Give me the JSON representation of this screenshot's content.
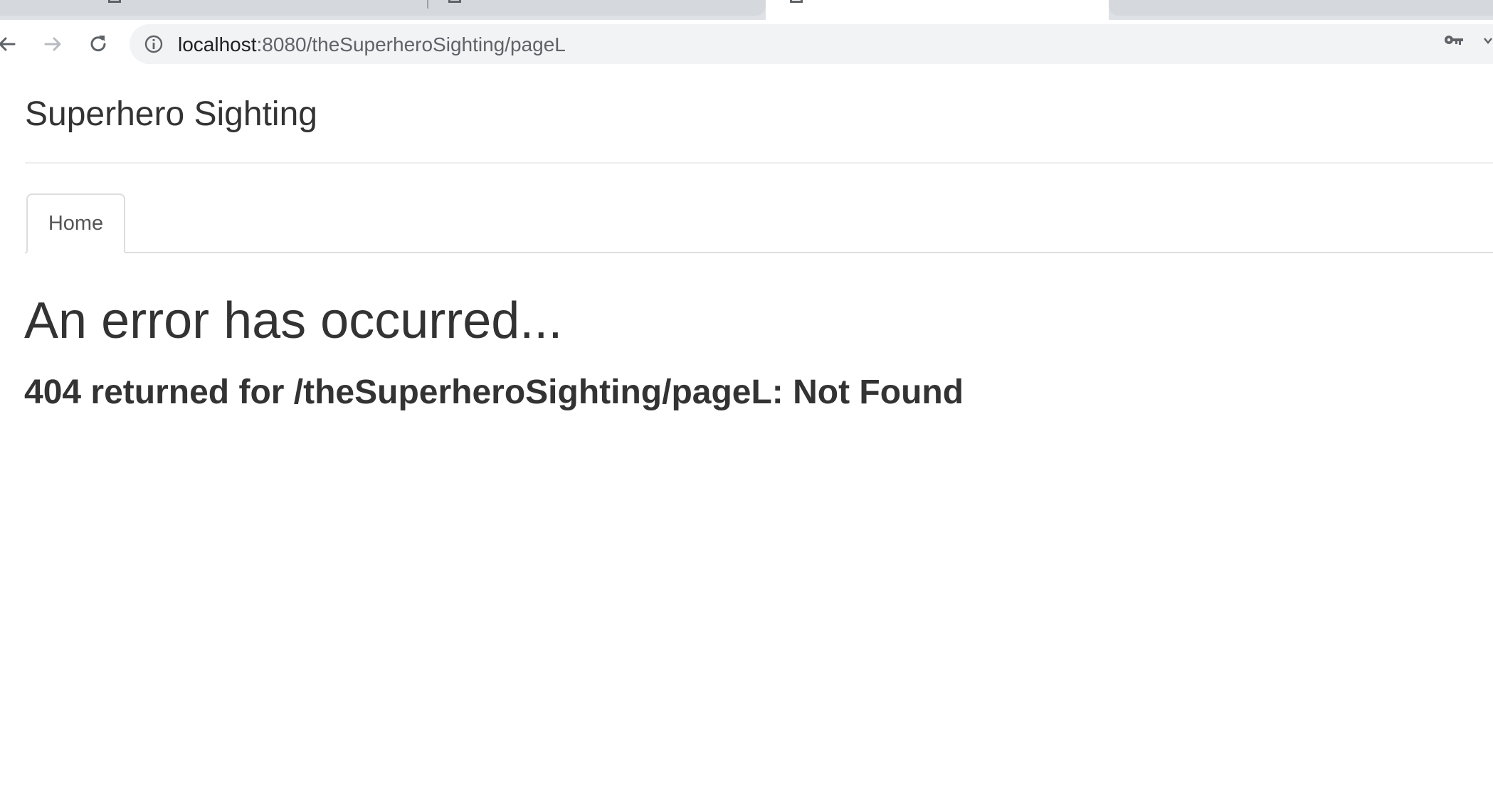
{
  "browser": {
    "url_host": "localhost",
    "url_path": ":8080/theSuperheroSighting/pageL",
    "icons": {
      "back": "back-arrow-icon",
      "forward": "forward-arrow-icon",
      "reload": "reload-icon",
      "info": "info-icon",
      "key": "key-icon",
      "menu": "chevron-down-icon"
    }
  },
  "header": {
    "brand": "Superhero Sighting"
  },
  "nav": {
    "tabs": [
      {
        "label": "Home"
      }
    ]
  },
  "main": {
    "error_title": "An error has occurred...",
    "error_message": "404 returned for /theSuperheroSighting/pageL: Not Found"
  },
  "colors": {
    "text": "#333333",
    "tab_border": "#dddddd",
    "omnibox_bg": "#f1f3f4",
    "tabstrip_bg": "#dee1e6"
  }
}
